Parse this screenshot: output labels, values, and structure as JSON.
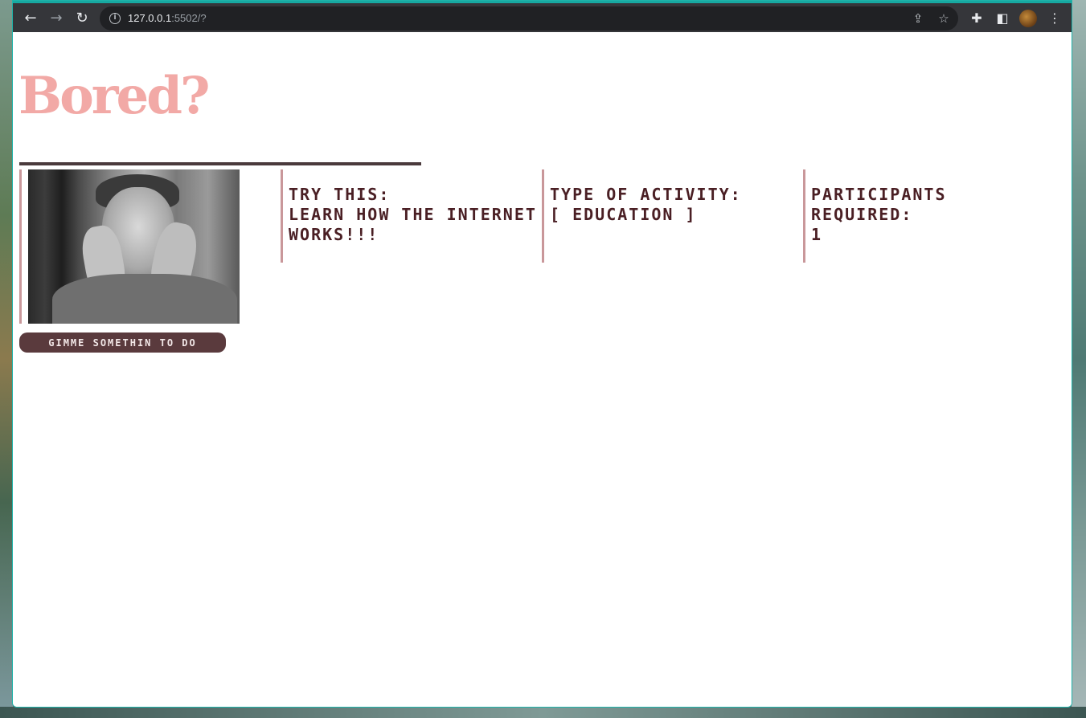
{
  "browser": {
    "url_host": "127.0.0.1",
    "url_rest": ":5502/?",
    "icons": {
      "back": "arrow-left-icon",
      "forward": "arrow-right-icon",
      "reload": "reload-icon",
      "info": "info-icon",
      "share": "share-icon",
      "bookmark": "star-icon",
      "extensions": "puzzle-icon",
      "sidepanel": "side-panel-icon",
      "profile": "avatar",
      "menu": "kebab-menu-icon"
    }
  },
  "page": {
    "title": "Bored?",
    "try_this_label": "Try this:",
    "activity": "learn how the internet works!!!",
    "type_label": "type of activity:",
    "type_value": "[ education ]",
    "participants_label": "participants required:",
    "participants_value": "1",
    "button_label": "gimme somethin to do"
  },
  "colors": {
    "title": "#f2a9a6",
    "text": "#4a1f24",
    "accent_border": "#c9979a",
    "button_bg": "#5a3a3d",
    "rule": "#4a3a3c"
  }
}
